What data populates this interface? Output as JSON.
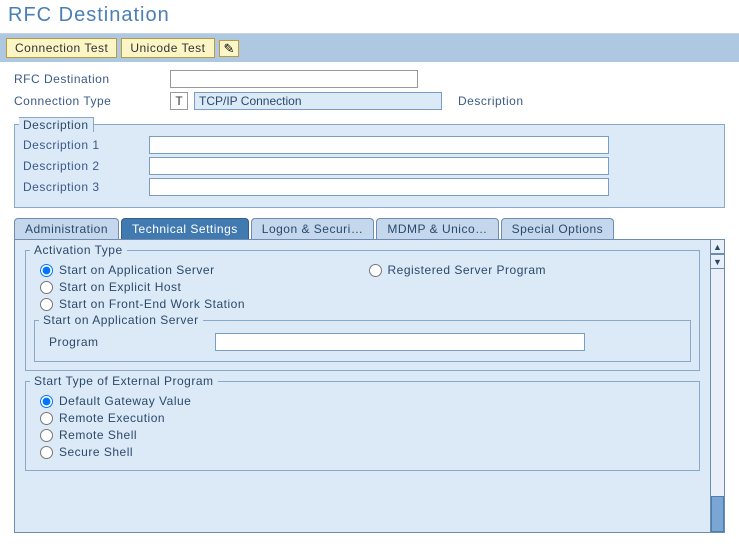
{
  "page_title": "RFC Destination",
  "toolbar": {
    "conn_test": "Connection Test",
    "unicode_test": "Unicode Test",
    "edit_icon": "✎"
  },
  "form": {
    "rfc_dest_label": "RFC Destination",
    "rfc_dest_value": "",
    "conn_type_label": "Connection Type",
    "conn_type_code": "T",
    "conn_type_text": "TCP/IP Connection",
    "description_label": "Description"
  },
  "desc_group": {
    "title": "Description",
    "d1_label": "Description 1",
    "d2_label": "Description 2",
    "d3_label": "Description 3",
    "d1": "",
    "d2": "",
    "d3": ""
  },
  "tabs": {
    "t1": "Administration",
    "t2": "Technical Settings",
    "t3": "Logon & Securi…",
    "t4": "MDMP & Unico…",
    "t5": "Special Options"
  },
  "activation": {
    "title": "Activation Type",
    "r1": "Start on Application Server",
    "r2": "Start on Explicit Host",
    "r3": "Start on Front-End Work Station",
    "r4": "Registered Server Program",
    "selected": "r1"
  },
  "sas": {
    "title": "Start on Application Server",
    "program_label": "Program",
    "program_value": ""
  },
  "start_ext": {
    "title": "Start Type of External Program",
    "r1": "Default Gateway Value",
    "r2": "Remote Execution",
    "r3": "Remote Shell",
    "r4": "Secure Shell",
    "selected": "r1"
  }
}
